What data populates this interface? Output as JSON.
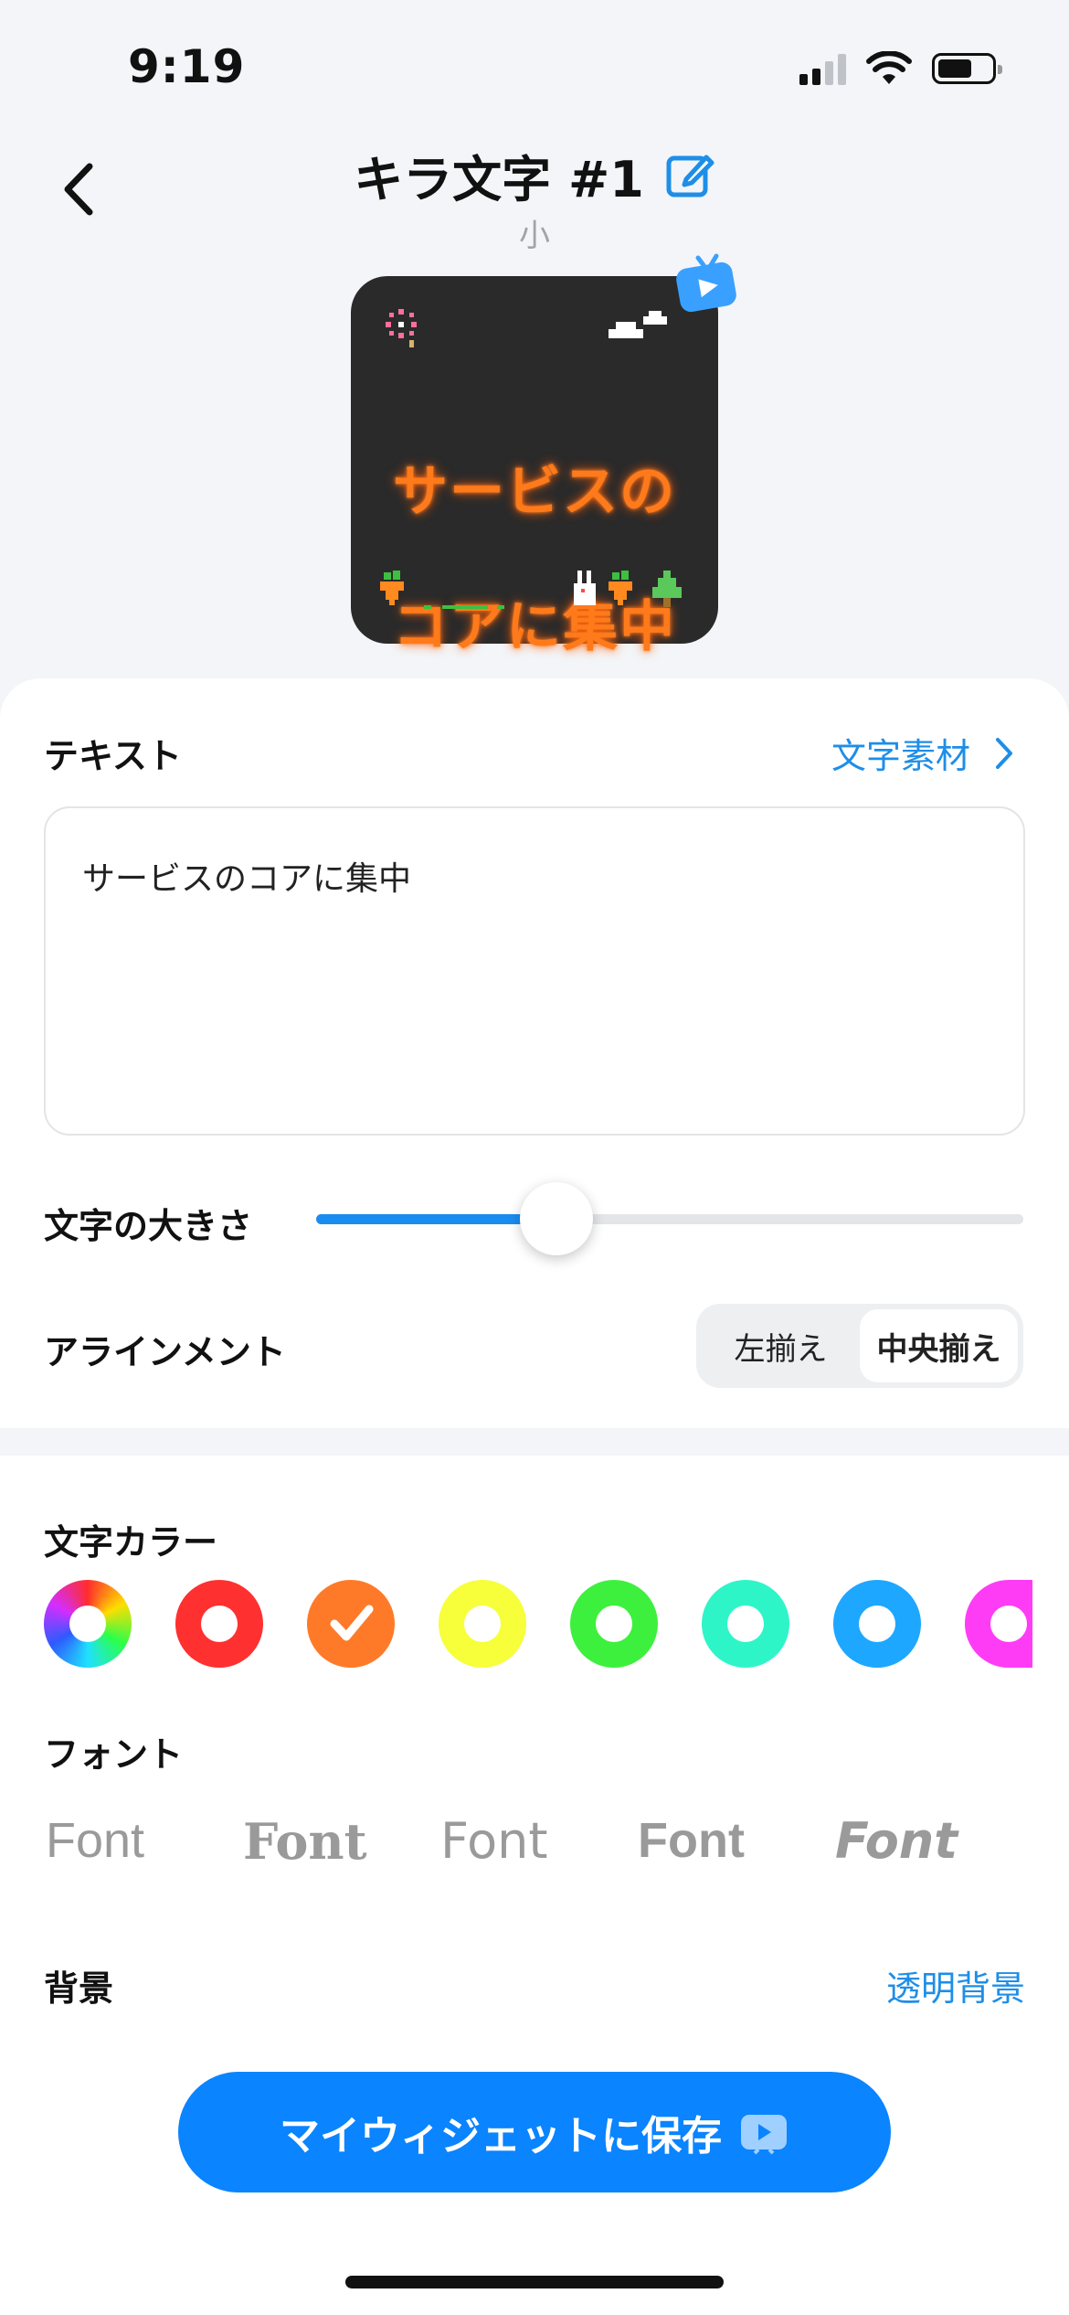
{
  "status": {
    "time": "9:19"
  },
  "header": {
    "title": "キラ文字 #1",
    "subtitle": "小"
  },
  "preview": {
    "text_line1": "サービスの",
    "text_line2": "コアに集中",
    "text_color": "#ff7a1a",
    "background": "#2a2a2a"
  },
  "text_section": {
    "label": "テキスト",
    "link_label": "文字素材",
    "value": "サービスのコアに集中"
  },
  "size_section": {
    "label": "文字の大きさ",
    "slider_value": 0.34
  },
  "alignment_section": {
    "label": "アラインメント",
    "options": [
      "左揃え",
      "中央揃え"
    ],
    "selected": "中央揃え"
  },
  "color_section": {
    "label": "文字カラー",
    "swatches": [
      {
        "name": "rainbow",
        "color": "conic"
      },
      {
        "name": "red",
        "color": "#ff3030"
      },
      {
        "name": "orange",
        "color": "#ff7a28",
        "selected": true
      },
      {
        "name": "yellow",
        "color": "#f6ff3a"
      },
      {
        "name": "green",
        "color": "#3ef03e"
      },
      {
        "name": "teal",
        "color": "#2ef5c8"
      },
      {
        "name": "blue",
        "color": "#1ea7ff"
      },
      {
        "name": "magenta",
        "color": "#ff3cf5"
      }
    ]
  },
  "font_section": {
    "label": "フォント",
    "options": [
      "Font",
      "Font",
      "Font",
      "Font",
      "Font"
    ]
  },
  "background_section": {
    "label": "背景",
    "value": "透明背景"
  },
  "save_button": {
    "label": "マイウィジェットに保存"
  }
}
